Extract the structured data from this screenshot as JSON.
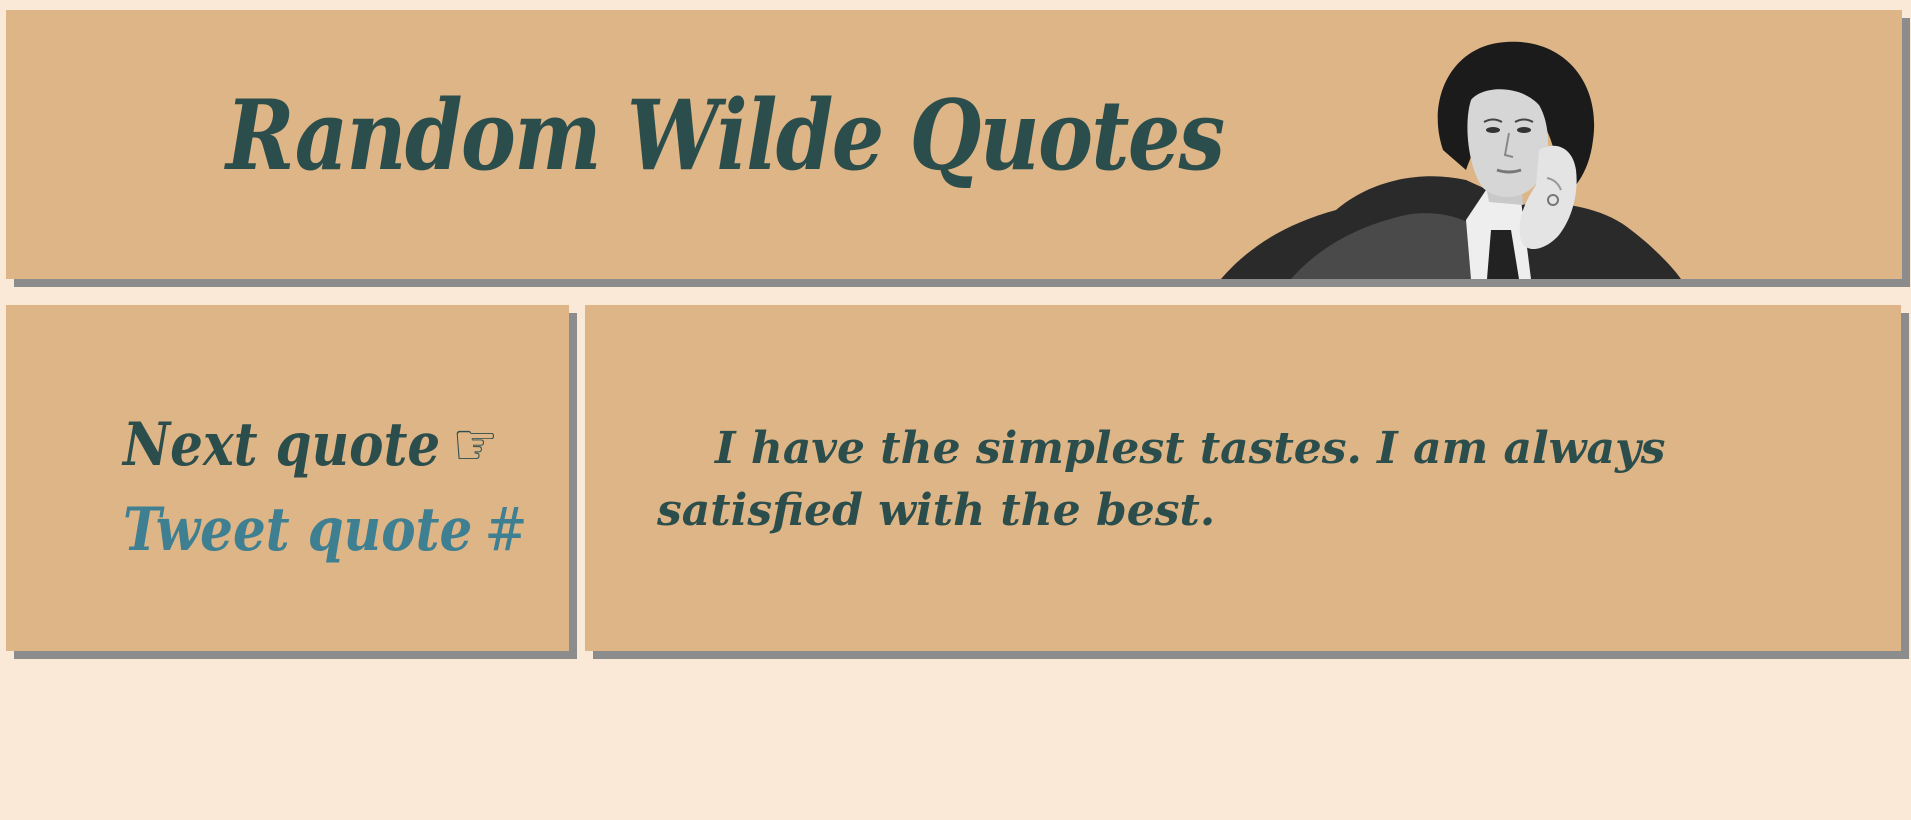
{
  "header": {
    "title": "Random Wilde Quotes",
    "portrait_alt": "Portrait of Oscar Wilde"
  },
  "controls": {
    "next_label": "Next quote",
    "next_icon": "☞",
    "tweet_label": "Tweet quote",
    "tweet_icon": "#"
  },
  "quote": {
    "text": "I have the simplest tastes. I am always satisfied with the best."
  },
  "colors": {
    "page_background": "#f9e9d6",
    "panel_background": "#ddb586",
    "panel_shadow": "#8c8c8c",
    "text_dark": "#2b4e4d",
    "link_blue": "#3e7f92"
  }
}
